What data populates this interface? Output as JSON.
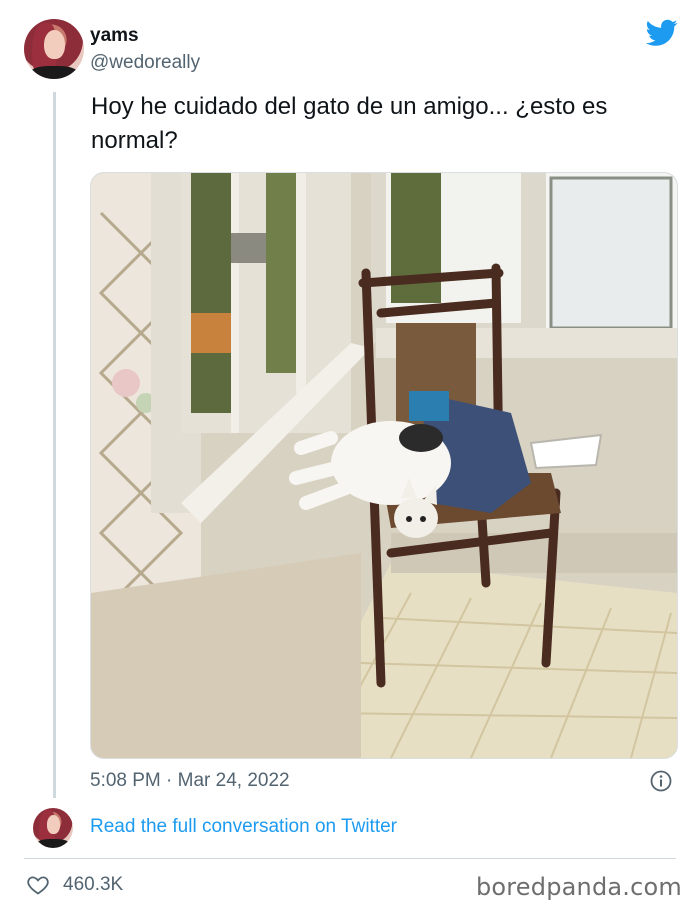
{
  "tweet": {
    "display_name": "yams",
    "handle": "@wedoreally",
    "text": "Hoy he cuidado del gato de un amigo... ¿esto es normal?",
    "timestamp": "5:08 PM · Mar 24, 2022",
    "likes": "460.3K"
  },
  "footer": {
    "read_conversation": "Read the full conversation on Twitter",
    "watermark": "boredpanda.com"
  },
  "icons": {
    "logo": "twitter-bird-icon",
    "info": "info-icon",
    "like": "heart-icon"
  },
  "colors": {
    "accent": "#1d9bf0",
    "text": "#0f1419",
    "secondary": "#536471",
    "divider": "#cfd9de"
  }
}
